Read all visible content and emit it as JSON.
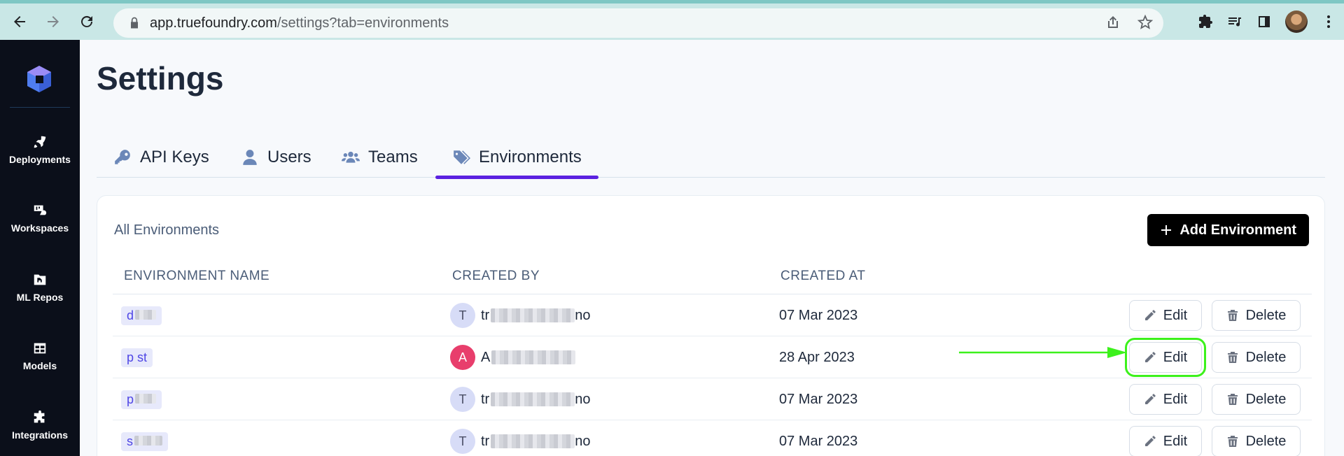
{
  "browser": {
    "url_host": "app.truefoundry.com",
    "url_path": "/settings?tab=environments"
  },
  "sidebar": {
    "items": [
      {
        "label": "Deployments",
        "icon": "rocket-icon"
      },
      {
        "label": "Workspaces",
        "icon": "workspaces-icon"
      },
      {
        "label": "ML Repos",
        "icon": "folder-icon"
      },
      {
        "label": "Models",
        "icon": "table-icon"
      },
      {
        "label": "Integrations",
        "icon": "puzzle-icon"
      }
    ]
  },
  "page": {
    "title": "Settings"
  },
  "tabs": [
    {
      "label": "API Keys",
      "icon": "key-icon"
    },
    {
      "label": "Users",
      "icon": "user-icon"
    },
    {
      "label": "Teams",
      "icon": "users-icon"
    },
    {
      "label": "Environments",
      "icon": "tags-icon",
      "active": true
    }
  ],
  "card": {
    "title": "All Environments",
    "add_label": "Add Environment"
  },
  "table": {
    "headers": [
      "ENVIRONMENT NAME",
      "CREATED BY",
      "CREATED AT"
    ],
    "rows": [
      {
        "name": "d",
        "creator_initial": "T",
        "creator_visible": "tr",
        "creator_suffix": "no",
        "created_at": "07 Mar 2023"
      },
      {
        "name": "p st",
        "creator_initial": "A",
        "creator_visible": "A",
        "creator_suffix": "",
        "created_at": "28 Apr 2023"
      },
      {
        "name": "p",
        "creator_initial": "T",
        "creator_visible": "tr",
        "creator_suffix": "no",
        "created_at": "07 Mar 2023"
      },
      {
        "name": "s",
        "creator_initial": "T",
        "creator_visible": "tr",
        "creator_suffix": "no",
        "created_at": "07 Mar 2023"
      }
    ],
    "edit_label": "Edit",
    "delete_label": "Delete"
  },
  "colors": {
    "accent": "#5b21e0",
    "highlight": "#3cf11c",
    "sidebar_bg": "#0b0f1a"
  }
}
